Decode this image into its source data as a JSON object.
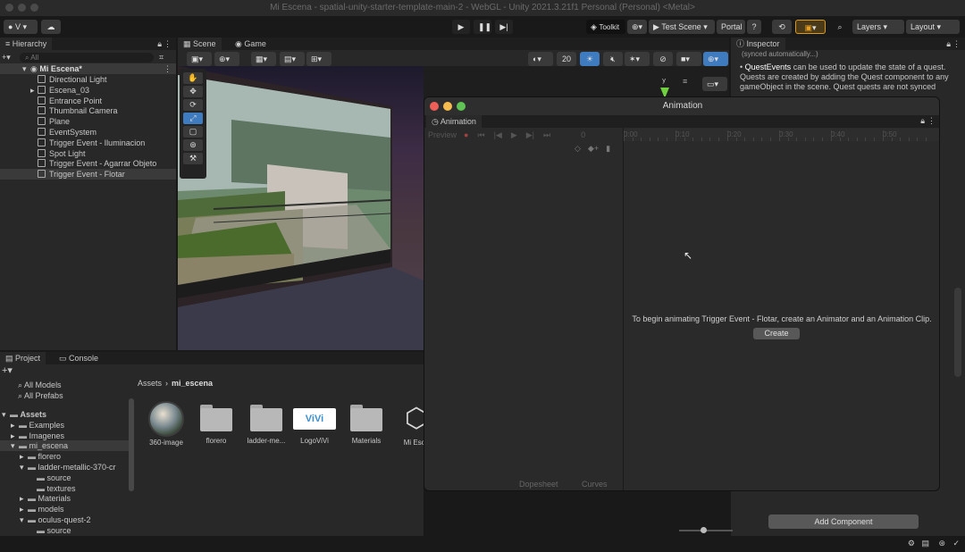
{
  "window_title": "Mi Escena - spatial-unity-starter-template-main-2 - WebGL - Unity 2021.3.21f1 Personal (Personal) <Metal>",
  "toolbar": {
    "account_label": "V",
    "toolkit_label": "Toolkit",
    "test_scene_label": "Test Scene",
    "portal_label": "Portal",
    "layers_label": "Layers",
    "layout_label": "Layout"
  },
  "hierarchy": {
    "tab_label": "Hierarchy",
    "search_placeholder": "All",
    "scene_name": "Mi Escena*",
    "items": [
      {
        "label": "Directional Light"
      },
      {
        "label": "Escena_03"
      },
      {
        "label": "Entrance Point"
      },
      {
        "label": "Thumbnail Camera"
      },
      {
        "label": "Plane"
      },
      {
        "label": "EventSystem"
      },
      {
        "label": "Trigger Event - Iluminacion"
      },
      {
        "label": "Spot Light"
      },
      {
        "label": "Trigger Event - Agarrar Objeto"
      },
      {
        "label": "Trigger Event - Flotar"
      }
    ]
  },
  "scene_tabs": {
    "scene_label": "Scene",
    "game_label": "Game",
    "grid_value": "20"
  },
  "inspector": {
    "tab_label": "Inspector",
    "bullet_term": "QuestEvents",
    "bullet_text": " can be used to update the state of a quest. Quests are created by adding the Quest component to any gameObject in the scene. Quest quests are not synced",
    "top_text": "(synced automatically...)",
    "add_component_label": "Add Component"
  },
  "animation": {
    "window_title": "Animation",
    "tab_label": "Animation",
    "preview_label": "Preview",
    "frame_value": "0",
    "ruler_ticks": [
      "0:00",
      "0:10",
      "0:20",
      "0:30",
      "0:40",
      "0:50"
    ],
    "message": "To begin animating Trigger Event - Flotar, create an Animator and an Animation Clip.",
    "create_label": "Create",
    "dopesheet_label": "Dopesheet",
    "curves_label": "Curves"
  },
  "project": {
    "tab_label": "Project",
    "console_label": "Console",
    "favorites": [
      "All Models",
      "All Prefabs"
    ],
    "tree": [
      {
        "label": "Assets",
        "depth": 0
      },
      {
        "label": "Examples",
        "depth": 1
      },
      {
        "label": "Imagenes",
        "depth": 1
      },
      {
        "label": "mi_escena",
        "depth": 1
      },
      {
        "label": "florero",
        "depth": 2
      },
      {
        "label": "ladder-metallic-370-cr",
        "depth": 2
      },
      {
        "label": "source",
        "depth": 3
      },
      {
        "label": "textures",
        "depth": 3
      },
      {
        "label": "Materials",
        "depth": 2
      },
      {
        "label": "models",
        "depth": 2
      },
      {
        "label": "oculus-quest-2",
        "depth": 2
      },
      {
        "label": "source",
        "depth": 3
      }
    ],
    "breadcrumb_root": "Assets",
    "breadcrumb_leaf": "mi_escena",
    "assets": [
      {
        "label": "360-image",
        "kind": "sphere"
      },
      {
        "label": "florero",
        "kind": "folder"
      },
      {
        "label": "ladder-me...",
        "kind": "folder"
      },
      {
        "label": "LogoViVi",
        "kind": "logo"
      },
      {
        "label": "Materials",
        "kind": "folder"
      },
      {
        "label": "Mi Esce",
        "kind": "unity"
      }
    ],
    "logo_text": "ViVi"
  },
  "colors": {
    "accent_blue": "#3e7bbf",
    "record_red": "#c94a4a",
    "traffic_red": "#ee5f57",
    "traffic_yellow": "#f5bd4f",
    "traffic_green": "#5fc453"
  }
}
